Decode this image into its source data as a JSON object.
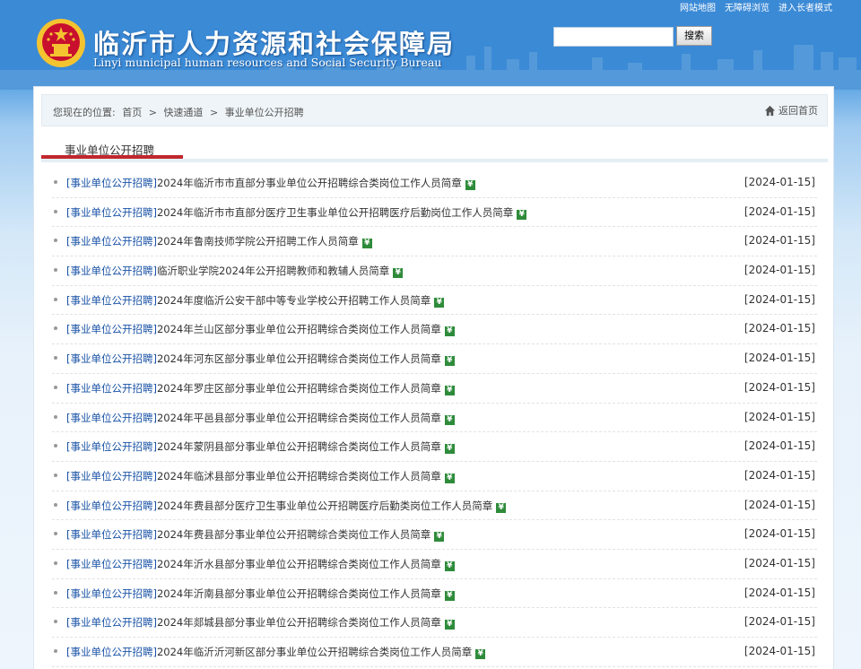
{
  "header": {
    "top_links": [
      "网站地图",
      "无障碍浏览",
      "进入长者模式"
    ],
    "title": "临沂市人力资源和社会保障局",
    "subtitle": "Linyi municipal human resources and Social Security Bureau",
    "search": {
      "value": "",
      "button": "搜索"
    },
    "colors": {
      "sky_top": "#2a7fd0",
      "emblem_red": "#c8102e",
      "emblem_gold": "#f4c430"
    }
  },
  "breadcrumb": {
    "prefix": "您现在的位置:",
    "items": [
      "首页",
      ">",
      "快速通道",
      ">",
      "事业单位公开招聘"
    ],
    "back_home": "返回首页"
  },
  "section": {
    "title": "事业单位公开招聘",
    "accent": "#c1272d"
  },
  "list": {
    "category": "[事业单位公开招聘]",
    "new_icon": "new-icon",
    "items": [
      {
        "title": "2024年临沂市市直部分事业单位公开招聘综合类岗位工作人员简章",
        "date": "[2024-01-15]"
      },
      {
        "title": "2024年临沂市市直部分医疗卫生事业单位公开招聘医疗后勤岗位工作人员简章",
        "date": "[2024-01-15]"
      },
      {
        "title": "2024年鲁南技师学院公开招聘工作人员简章",
        "date": "[2024-01-15]"
      },
      {
        "title": "临沂职业学院2024年公开招聘教师和教辅人员简章",
        "date": "[2024-01-15]"
      },
      {
        "title": "2024年度临沂公安干部中等专业学校公开招聘工作人员简章",
        "date": "[2024-01-15]"
      },
      {
        "title": "2024年兰山区部分事业单位公开招聘综合类岗位工作人员简章",
        "date": "[2024-01-15]"
      },
      {
        "title": "2024年河东区部分事业单位公开招聘综合类岗位工作人员简章",
        "date": "[2024-01-15]"
      },
      {
        "title": "2024年罗庄区部分事业单位公开招聘综合类岗位工作人员简章",
        "date": "[2024-01-15]"
      },
      {
        "title": "2024年平邑县部分事业单位公开招聘综合类岗位工作人员简章",
        "date": "[2024-01-15]"
      },
      {
        "title": "2024年蒙阴县部分事业单位公开招聘综合类岗位工作人员简章",
        "date": "[2024-01-15]"
      },
      {
        "title": "2024年临沭县部分事业单位公开招聘综合类岗位工作人员简章",
        "date": "[2024-01-15]"
      },
      {
        "title": "2024年费县部分医疗卫生事业单位公开招聘医疗后勤类岗位工作人员简章",
        "date": "[2024-01-15]"
      },
      {
        "title": "2024年费县部分事业单位公开招聘综合类岗位工作人员简章",
        "date": "[2024-01-15]"
      },
      {
        "title": "2024年沂水县部分事业单位公开招聘综合类岗位工作人员简章",
        "date": "[2024-01-15]"
      },
      {
        "title": "2024年沂南县部分事业单位公开招聘综合类岗位工作人员简章",
        "date": "[2024-01-15]"
      },
      {
        "title": "2024年郯城县部分事业单位公开招聘综合类岗位工作人员简章",
        "date": "[2024-01-15]"
      },
      {
        "title": "2024年临沂沂河新区部分事业单位公开招聘综合类岗位工作人员简章",
        "date": "[2024-01-15]"
      }
    ]
  }
}
